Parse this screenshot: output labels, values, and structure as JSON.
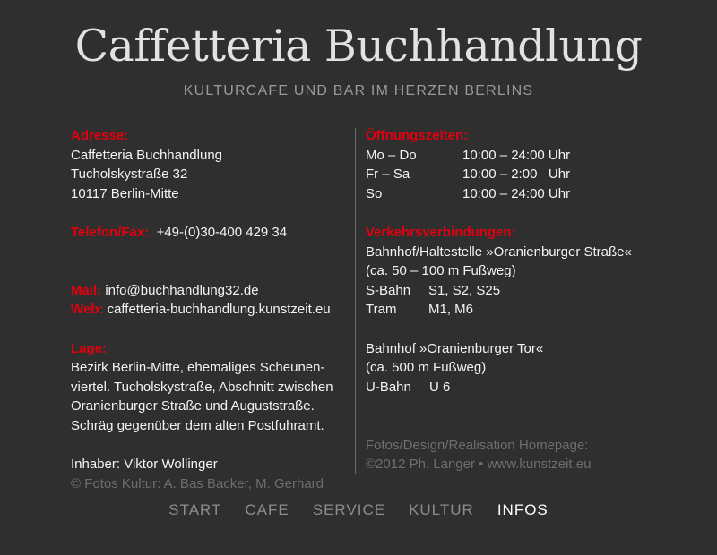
{
  "header": {
    "title": "Caffetteria Buchhandlung",
    "subtitle": "KULTURCAFE UND BAR IM HERZEN BERLINS"
  },
  "address": {
    "label": "Adresse:",
    "lines": [
      "Caffetteria Buchhandlung",
      "Tucholskystraße 32",
      "10117 Berlin-Mitte"
    ]
  },
  "phone": {
    "label": "Telefon/Fax:",
    "value": "+49-(0)30-400 429 34"
  },
  "mail": {
    "label": "Mail:",
    "value": "info@buchhandlung32.de"
  },
  "web": {
    "label": "Web:",
    "value": "caffetteria-buchhandlung.kunstzeit.eu"
  },
  "location": {
    "label": "Lage:",
    "lines": [
      "Bezirk Berlin-Mitte, ehemaliges Scheunen-",
      "viertel. Tucholskystraße, Abschnitt zwischen",
      "Oranienburger Straße und Auguststraße.",
      "Schräg gegenüber dem alten Postfuhramt."
    ]
  },
  "owner": "Inhaber: Viktor Wollinger",
  "photo_credit": "© Fotos Kultur: A. Bas Backer, M. Gerhard",
  "hours": {
    "label": "Öffnungszeiten:",
    "rows": [
      {
        "day": "Mo – Do",
        "time": "10:00 – 24:00 Uhr"
      },
      {
        "day": "Fr – Sa",
        "time": "10:00 – 2:00   Uhr"
      },
      {
        "day": "So",
        "time": "10:00 – 24:00 Uhr"
      }
    ]
  },
  "transit": {
    "label": "Verkehrsverbindungen:",
    "station1": {
      "name": "Bahnhof/Haltestelle »Oranienburger Straße«",
      "distance": "(ca. 50 – 100 m Fußweg)",
      "lines": [
        {
          "type": "S-Bahn",
          "value": "S1, S2, S25"
        },
        {
          "type": "Tram",
          "value": "M1, M6"
        }
      ]
    },
    "station2": {
      "name": "Bahnhof »Oranienburger Tor«",
      "distance": "(ca. 500 m Fußweg)",
      "lines": [
        {
          "type": "U-Bahn",
          "value": "U 6"
        }
      ]
    }
  },
  "credits": {
    "line1": "Fotos/Design/Realisation Homepage:",
    "line2": "©2012 Ph. Langer • www.kunstzeit.eu"
  },
  "nav": {
    "items": [
      {
        "label": "START",
        "active": false
      },
      {
        "label": "CAFE",
        "active": false
      },
      {
        "label": "SERVICE",
        "active": false
      },
      {
        "label": "KULTUR",
        "active": false
      },
      {
        "label": "INFOS",
        "active": true
      }
    ]
  },
  "colors": {
    "background": "#2f2f2f",
    "accent": "#e3000f",
    "text": "#f4f4f4",
    "muted": "#6e6e6e",
    "nav_inactive": "#8c8c8c",
    "nav_active": "#ffffff"
  }
}
